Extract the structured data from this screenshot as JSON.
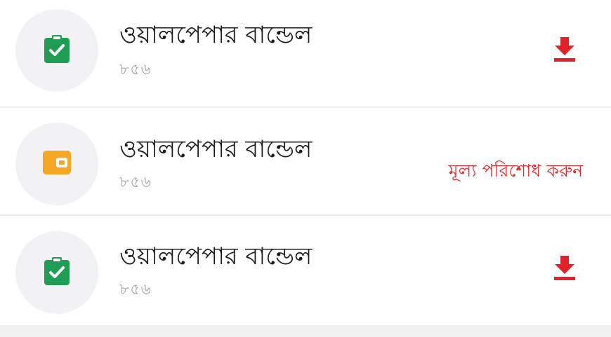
{
  "colors": {
    "accent": "#e0232b",
    "check_green": "#1f9d55",
    "wallet_orange": "#f5a623",
    "avatar_bg": "#f2f2f4",
    "title_text": "#1d1d1d",
    "sub_text": "#a9a9ad"
  },
  "items": [
    {
      "title": "ওয়ালপেপার বান্ডেল",
      "count": "৮৫৬",
      "status_icon": "clipboard-check-icon",
      "action": "download",
      "action_icon": "download-icon"
    },
    {
      "title": "ওয়ালপেপার বান্ডেল",
      "count": "৮৫৬",
      "status_icon": "wallet-icon",
      "action": "pay",
      "action_label": "মূল্য পরিশোধ করুন"
    },
    {
      "title": "ওয়ালপেপার বান্ডেল",
      "count": "৮৫৬",
      "status_icon": "clipboard-check-icon",
      "action": "download",
      "action_icon": "download-icon"
    }
  ]
}
